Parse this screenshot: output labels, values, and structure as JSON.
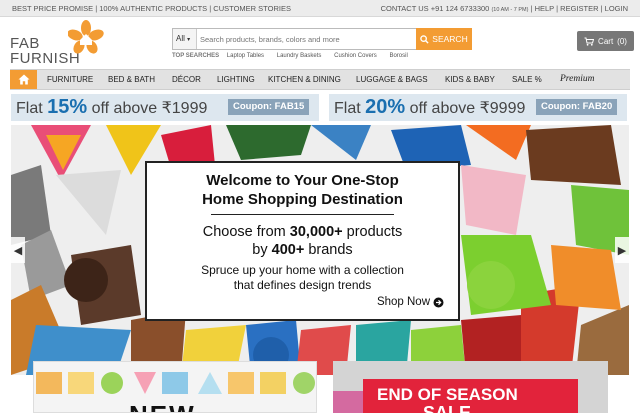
{
  "topbar": {
    "left_text": "BEST PRICE PROMISE | 100% AUTHENTIC PRODUCTS | CUSTOMER STORIES",
    "contact_text": "CONTACT US +91 124 6733300",
    "contact_hours": "(10 AM - 7 PM)",
    "help": "HELP",
    "register": "REGISTER",
    "login": "LOGIN",
    "sep": "|"
  },
  "logo": {
    "line1": "FAB",
    "line2": "FURNISH"
  },
  "search": {
    "category": "All",
    "placeholder": "Search products, brands, colors and more",
    "button_label": "SEARCH",
    "top_searches_label": "TOP SEARCHES",
    "top_searches": [
      "Laptop Tables",
      "Laundry Baskets",
      "Cushion Covers",
      "Borosil"
    ]
  },
  "cart": {
    "label": "Cart",
    "count": "(0)"
  },
  "nav": {
    "items": [
      "FURNITURE",
      "BED & BATH",
      "DÉCOR",
      "LIGHTING",
      "KITCHEN & DINING",
      "LUGGAGE & BAGS",
      "KIDS & BABY",
      "SALE %"
    ],
    "premium": "Premium"
  },
  "offers": [
    {
      "flat": "Flat",
      "percent": "15%",
      "above": "off above ₹1999",
      "coupon": "Coupon: FAB15"
    },
    {
      "flat": "Flat",
      "percent": "20%",
      "above": "off above ₹9999",
      "coupon": "Coupon: FAB20"
    }
  ],
  "hero": {
    "title_line1": "Welcome to Your One-Stop",
    "title_line2": "Home Shopping Destination",
    "choose_pre": "Choose from ",
    "products_count": "30,000+",
    "choose_post": " products",
    "by_pre": "by ",
    "brands_count": "400+",
    "by_post": " brands",
    "sub_line1": "Spruce up your home with a collection",
    "sub_line2": "that defines design trends",
    "shop_now": "Shop Now"
  },
  "promos": {
    "left_word": "NEW",
    "right_line1": "END OF SEASON",
    "right_line2": "SALE"
  },
  "colors": {
    "accent": "#f39c33",
    "offer_bg": "#dde7ef",
    "offer_number": "#1a6fb0",
    "coupon_bg": "#8aa3b9"
  }
}
